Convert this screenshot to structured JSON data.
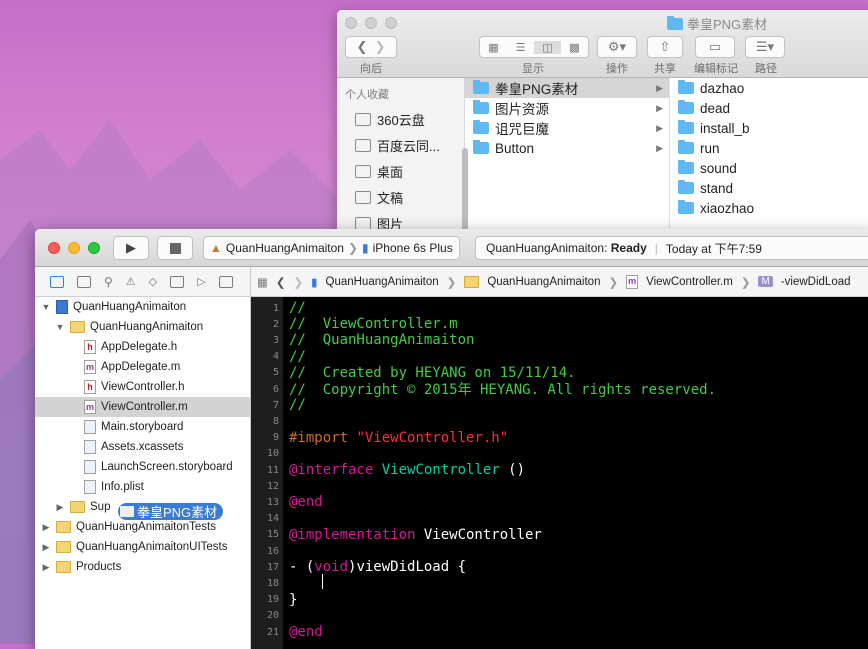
{
  "finder": {
    "title": "拳皇PNG素材",
    "toolbar_labels": {
      "back": "向后",
      "view": "显示",
      "action": "操作",
      "share": "共享",
      "tags": "编辑标记",
      "path": "路径"
    },
    "sidebar_header": "个人收藏",
    "sidebar_items": [
      {
        "label": "360云盘",
        "icon": "folder-icon"
      },
      {
        "label": "百度云同...",
        "icon": "folder-icon"
      },
      {
        "label": "桌面",
        "icon": "desktop-icon"
      },
      {
        "label": "文稿",
        "icon": "document-icon"
      },
      {
        "label": "图片",
        "icon": "camera-icon"
      }
    ],
    "column1": [
      "拳皇PNG素材",
      "图片资源",
      "诅咒巨魔",
      "Button"
    ],
    "column1_selected": "拳皇PNG素材",
    "column2": [
      "dazhao",
      "dead",
      "install_b",
      "run",
      "sound",
      "stand",
      "xiaozhao"
    ]
  },
  "xcode": {
    "scheme": "QuanHuangAnimaiton",
    "device": "iPhone 6s Plus",
    "status": {
      "project": "QuanHuangAnimaiton:",
      "state": "Ready",
      "sep": "|",
      "time": "Today at 下午7:59"
    },
    "jump_bar": [
      "QuanHuangAnimaiton",
      "QuanHuangAnimaiton",
      "ViewController.m",
      "-viewDidLoad"
    ],
    "navigator": [
      {
        "label": "QuanHuangAnimaiton",
        "indent": 0,
        "type": "project",
        "disc": "▼"
      },
      {
        "label": "QuanHuangAnimaiton",
        "indent": 1,
        "type": "folder",
        "disc": "▼"
      },
      {
        "label": "AppDelegate.h",
        "indent": 2,
        "type": "h"
      },
      {
        "label": "AppDelegate.m",
        "indent": 2,
        "type": "m"
      },
      {
        "label": "ViewController.h",
        "indent": 2,
        "type": "h"
      },
      {
        "label": "ViewController.m",
        "indent": 2,
        "type": "m",
        "selected": true
      },
      {
        "label": "Main.storyboard",
        "indent": 2,
        "type": "storyboard"
      },
      {
        "label": "Assets.xcassets",
        "indent": 2,
        "type": "assets"
      },
      {
        "label": "LaunchScreen.storyboard",
        "indent": 2,
        "type": "storyboard"
      },
      {
        "label": "Info.plist",
        "indent": 2,
        "type": "plist"
      },
      {
        "label": "Sup",
        "indent": 1,
        "type": "folder",
        "disc": "▶"
      },
      {
        "label": "QuanHuangAnimaitonTests",
        "indent": 0,
        "type": "folder",
        "disc": "▶"
      },
      {
        "label": "QuanHuangAnimaitonUITests",
        "indent": 0,
        "type": "folder",
        "disc": "▶"
      },
      {
        "label": "Products",
        "indent": 0,
        "type": "folder",
        "disc": "▶"
      }
    ],
    "drag_label": "拳皇PNG素材",
    "code_lines": [
      {
        "n": "1",
        "segs": [
          [
            "//",
            "c"
          ]
        ]
      },
      {
        "n": "2",
        "segs": [
          [
            "//  ViewController.m",
            "c"
          ]
        ]
      },
      {
        "n": "3",
        "segs": [
          [
            "//  QuanHuangAnimaiton",
            "c"
          ]
        ]
      },
      {
        "n": "4",
        "segs": [
          [
            "//",
            "c"
          ]
        ]
      },
      {
        "n": "5",
        "segs": [
          [
            "//  Created by HEYANG on 15/11/14.",
            "c"
          ]
        ]
      },
      {
        "n": "6",
        "segs": [
          [
            "//  Copyright © 2015年 HEYANG. All rights reserved.",
            "c"
          ]
        ]
      },
      {
        "n": "7",
        "segs": [
          [
            "//",
            "c"
          ]
        ]
      },
      {
        "n": "8",
        "segs": []
      },
      {
        "n": "9",
        "segs": [
          [
            "#import ",
            "p"
          ],
          [
            "\"ViewController.h\"",
            "s"
          ]
        ]
      },
      {
        "n": "10",
        "segs": []
      },
      {
        "n": "11",
        "segs": [
          [
            "@interface ",
            "k"
          ],
          [
            "ViewController",
            "t"
          ],
          [
            " ()",
            "w"
          ]
        ]
      },
      {
        "n": "12",
        "segs": []
      },
      {
        "n": "13",
        "segs": [
          [
            "@end",
            "k"
          ]
        ]
      },
      {
        "n": "14",
        "segs": []
      },
      {
        "n": "15",
        "segs": [
          [
            "@implementation ",
            "k"
          ],
          [
            "ViewController",
            "w"
          ]
        ]
      },
      {
        "n": "16",
        "segs": []
      },
      {
        "n": "17",
        "segs": [
          [
            "- (",
            "w"
          ],
          [
            "void",
            "k"
          ],
          [
            ")viewDidLoad {",
            "w"
          ]
        ]
      },
      {
        "n": "18",
        "segs": [
          [
            "    ",
            "w"
          ]
        ]
      },
      {
        "n": "19",
        "segs": [
          [
            "}",
            "w"
          ]
        ]
      },
      {
        "n": "20",
        "segs": []
      },
      {
        "n": "21",
        "segs": [
          [
            "@end",
            "k"
          ]
        ]
      }
    ],
    "colors": {
      "comment": "#41cc45",
      "keyword": "#d31895",
      "string": "#ff2c38",
      "preproc": "#c96d2c",
      "type": "#00d1a4",
      "plain": "#ffffff"
    }
  }
}
